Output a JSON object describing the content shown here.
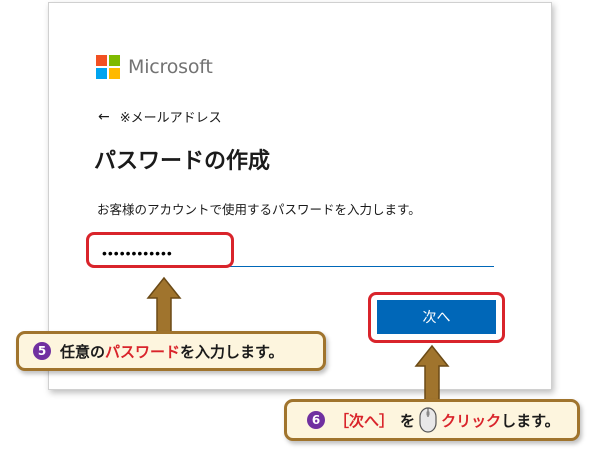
{
  "logo": {
    "name": "Microsoft",
    "colors": [
      "#f25022",
      "#7fba00",
      "#00a4ef",
      "#ffb900"
    ]
  },
  "back": {
    "label": "※メールアドレス",
    "icon": "back-arrow-icon"
  },
  "title": "パスワードの作成",
  "description": "お客様のアカウントで使用するパスワードを入力します。",
  "password": {
    "value": "••••••••••••"
  },
  "next_button": {
    "label": "次へ"
  },
  "callout1": {
    "number": "❺",
    "prefix": "任意の",
    "keyword": "パスワード",
    "suffix": "を入力します。"
  },
  "callout2": {
    "number": "❻",
    "bracket_open": "［",
    "keyword": "次へ",
    "bracket_close": "］",
    "particle": "を",
    "action": "クリック",
    "suffix": "します。",
    "icon": "mouse-icon"
  },
  "colors": {
    "primary": "#0067b8",
    "highlight": "#d9242b",
    "callout_bg": "#fdf5de",
    "callout_border": "#a0742d",
    "number_circle": "#7030a0"
  }
}
